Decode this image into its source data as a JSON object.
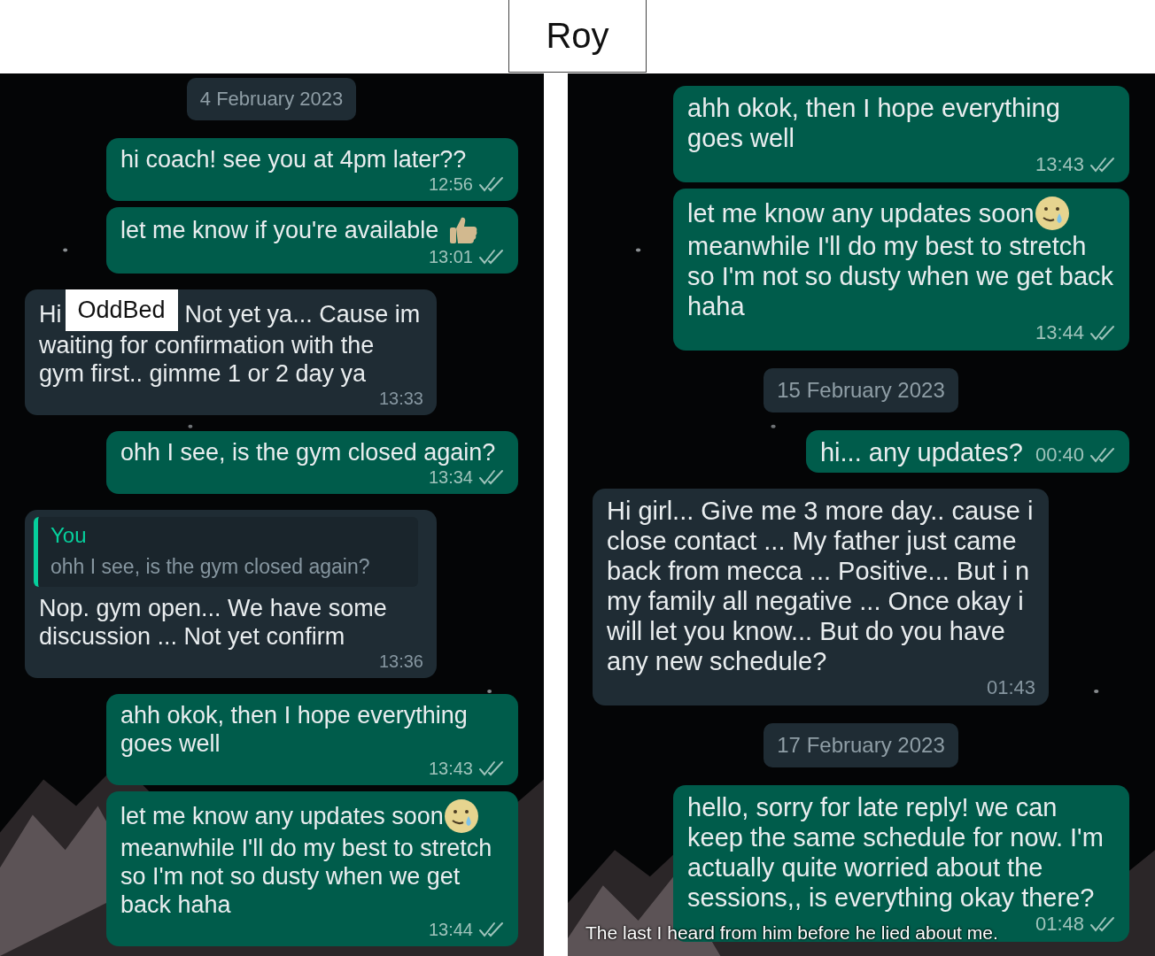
{
  "header": {
    "title": "Roy"
  },
  "panels": [
    {
      "messages": [
        {
          "kind": "date",
          "text": "4 February 2023"
        },
        {
          "kind": "sent",
          "text": "hi coach! see you at 4pm later??",
          "time": "12:56",
          "read": false
        },
        {
          "kind": "sent",
          "text": "let me know if you're available",
          "emoji": {
            "kind": "thumbs_up"
          },
          "time": "13:01",
          "read": false
        },
        {
          "kind": "received",
          "text": "Hi",
          "redaction": "OddBed",
          "text_after": "Not yet ya... Cause im",
          "text_continued": "waiting for confirmation with the gym first.. gimme 1 or 2 day ya",
          "time": "13:33"
        },
        {
          "kind": "sent",
          "text": "ohh I see, is the gym closed again?",
          "time": "13:34",
          "read": false
        },
        {
          "kind": "received",
          "quote": {
            "author": "You",
            "text": "ohh I see, is the gym closed again?"
          },
          "text": "Nop. gym open... We have some discussion ... Not yet confirm",
          "time": "13:36"
        },
        {
          "kind": "sent",
          "text": "ahh okok, then I hope everything goes well",
          "time": "13:43",
          "read": false
        },
        {
          "kind": "sent",
          "text": "let me know any updates soon",
          "emoji": {
            "kind": "smiling_tear"
          },
          "text_continued": "meanwhile I'll do my best to stretch so I'm not so dusty when we get back haha",
          "time": "13:44",
          "read": false
        }
      ]
    },
    {
      "messages": [
        {
          "kind": "sent",
          "text": "ahh okok, then I hope everything goes well",
          "time": "13:43",
          "read": false
        },
        {
          "kind": "sent",
          "text": "let me know any updates soon",
          "emoji": {
            "kind": "smiling_tear"
          },
          "text_continued": "meanwhile I'll do my best to stretch so I'm not so dusty when we get back haha",
          "time": "13:44",
          "read": false
        },
        {
          "kind": "date",
          "text": "15 February 2023"
        },
        {
          "kind": "sent",
          "text": "hi... any updates?",
          "time": "00:40",
          "read": false
        },
        {
          "kind": "received",
          "text": "Hi girl... Give me 3 more day.. cause i close contact ... My father just came back from mecca ... Positive... But i n my family all negative ... Once okay i will let you know... But do you have any new schedule?",
          "time": "01:43"
        },
        {
          "kind": "date",
          "text": "17 February 2023"
        },
        {
          "kind": "sent",
          "text": "hello, sorry for late reply! we can keep the same schedule for now. I'm actually quite worried about the sessions,, is everything okay there?",
          "time": "01:48",
          "read": false
        }
      ],
      "caption": "The last I heard from him before he lied about me."
    }
  ]
}
